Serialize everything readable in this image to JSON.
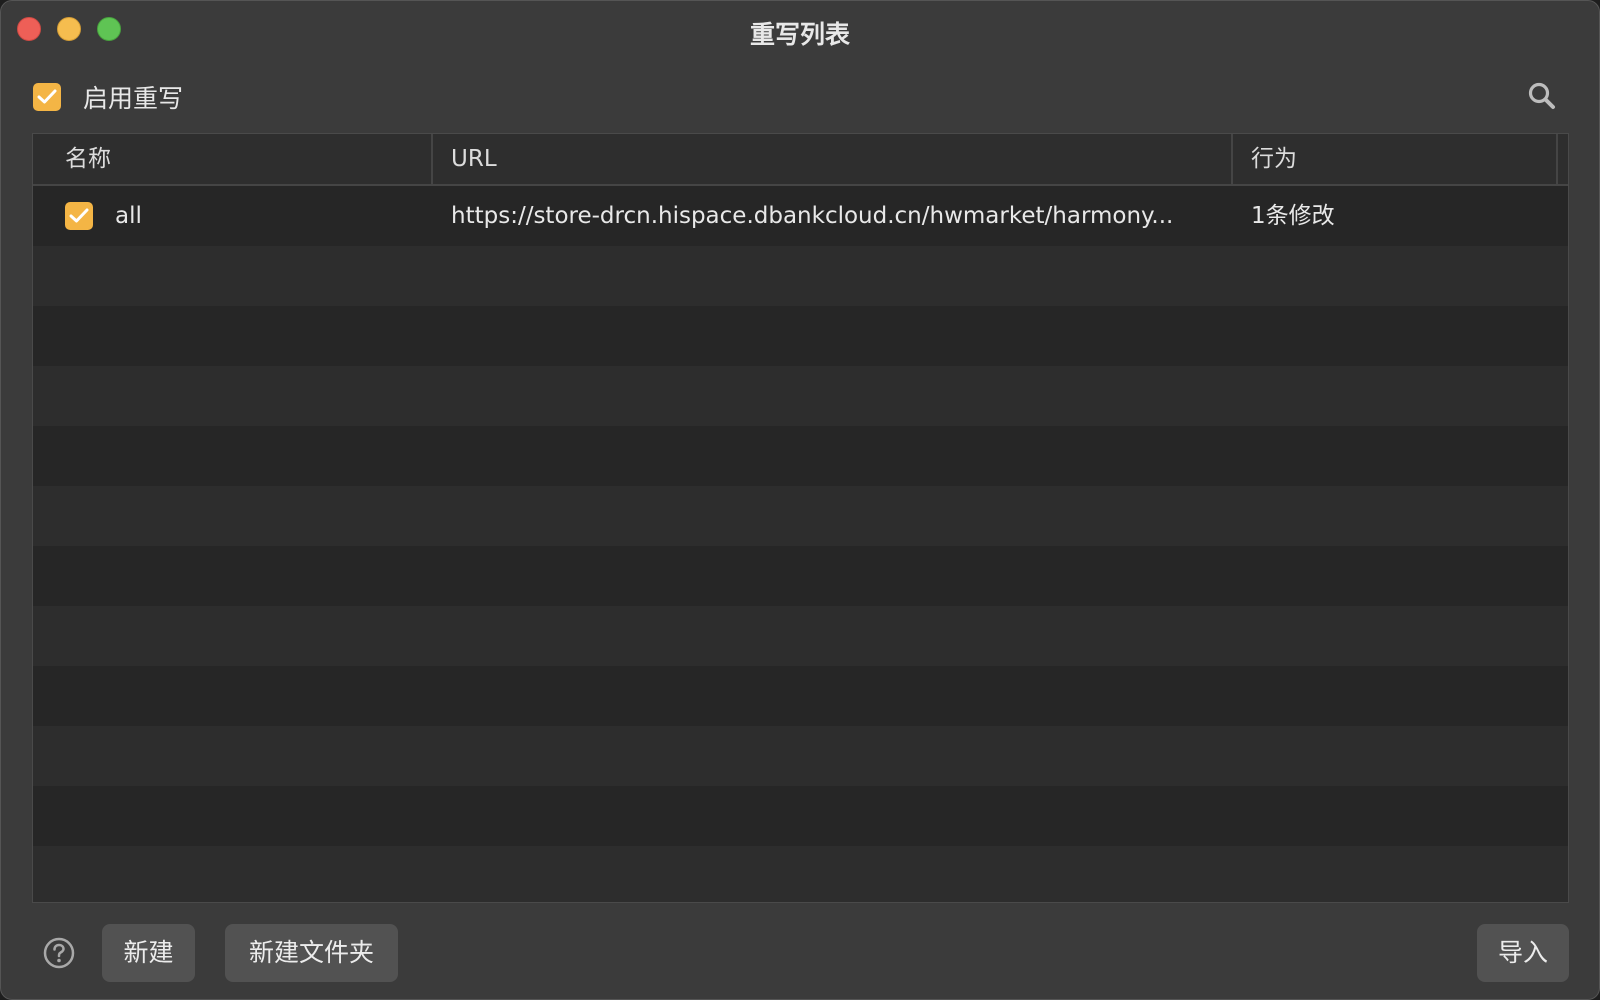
{
  "window": {
    "title": "重写列表"
  },
  "toolbar": {
    "enable_label": "启用重写",
    "enable_checked": true,
    "search_icon": "search-icon"
  },
  "table": {
    "columns": [
      "名称",
      "URL",
      "行为"
    ],
    "rows": [
      {
        "checked": true,
        "name": "all",
        "url": "https://store-drcn.hispace.dbankcloud.cn/hwmarket/harmony...",
        "action": "1条修改"
      }
    ]
  },
  "footer": {
    "help_icon": "help-circle-icon",
    "new_label": "新建",
    "new_folder_label": "新建文件夹",
    "import_label": "导入"
  },
  "colors": {
    "accent": "#f4b545",
    "close": "#ee5f57",
    "minimize": "#f5bd4f",
    "zoom": "#5fc454"
  }
}
